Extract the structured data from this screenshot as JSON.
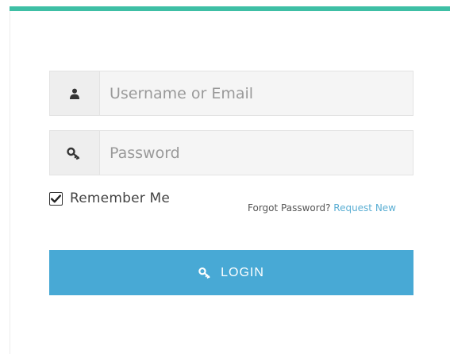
{
  "form": {
    "username": {
      "placeholder": "Username or Email",
      "value": "",
      "icon": "user-icon"
    },
    "password": {
      "placeholder": "Password",
      "value": "",
      "icon": "key-icon"
    },
    "remember": {
      "label": "Remember Me",
      "checked": true
    },
    "forgot": {
      "text": "Forgot Password?",
      "link_label": "Request New"
    },
    "login": {
      "label": "LOGIN",
      "icon": "key-icon"
    }
  },
  "colors": {
    "top_bar": "#3ebfa5",
    "button": "#48a9d5",
    "link": "#5aaed3"
  }
}
